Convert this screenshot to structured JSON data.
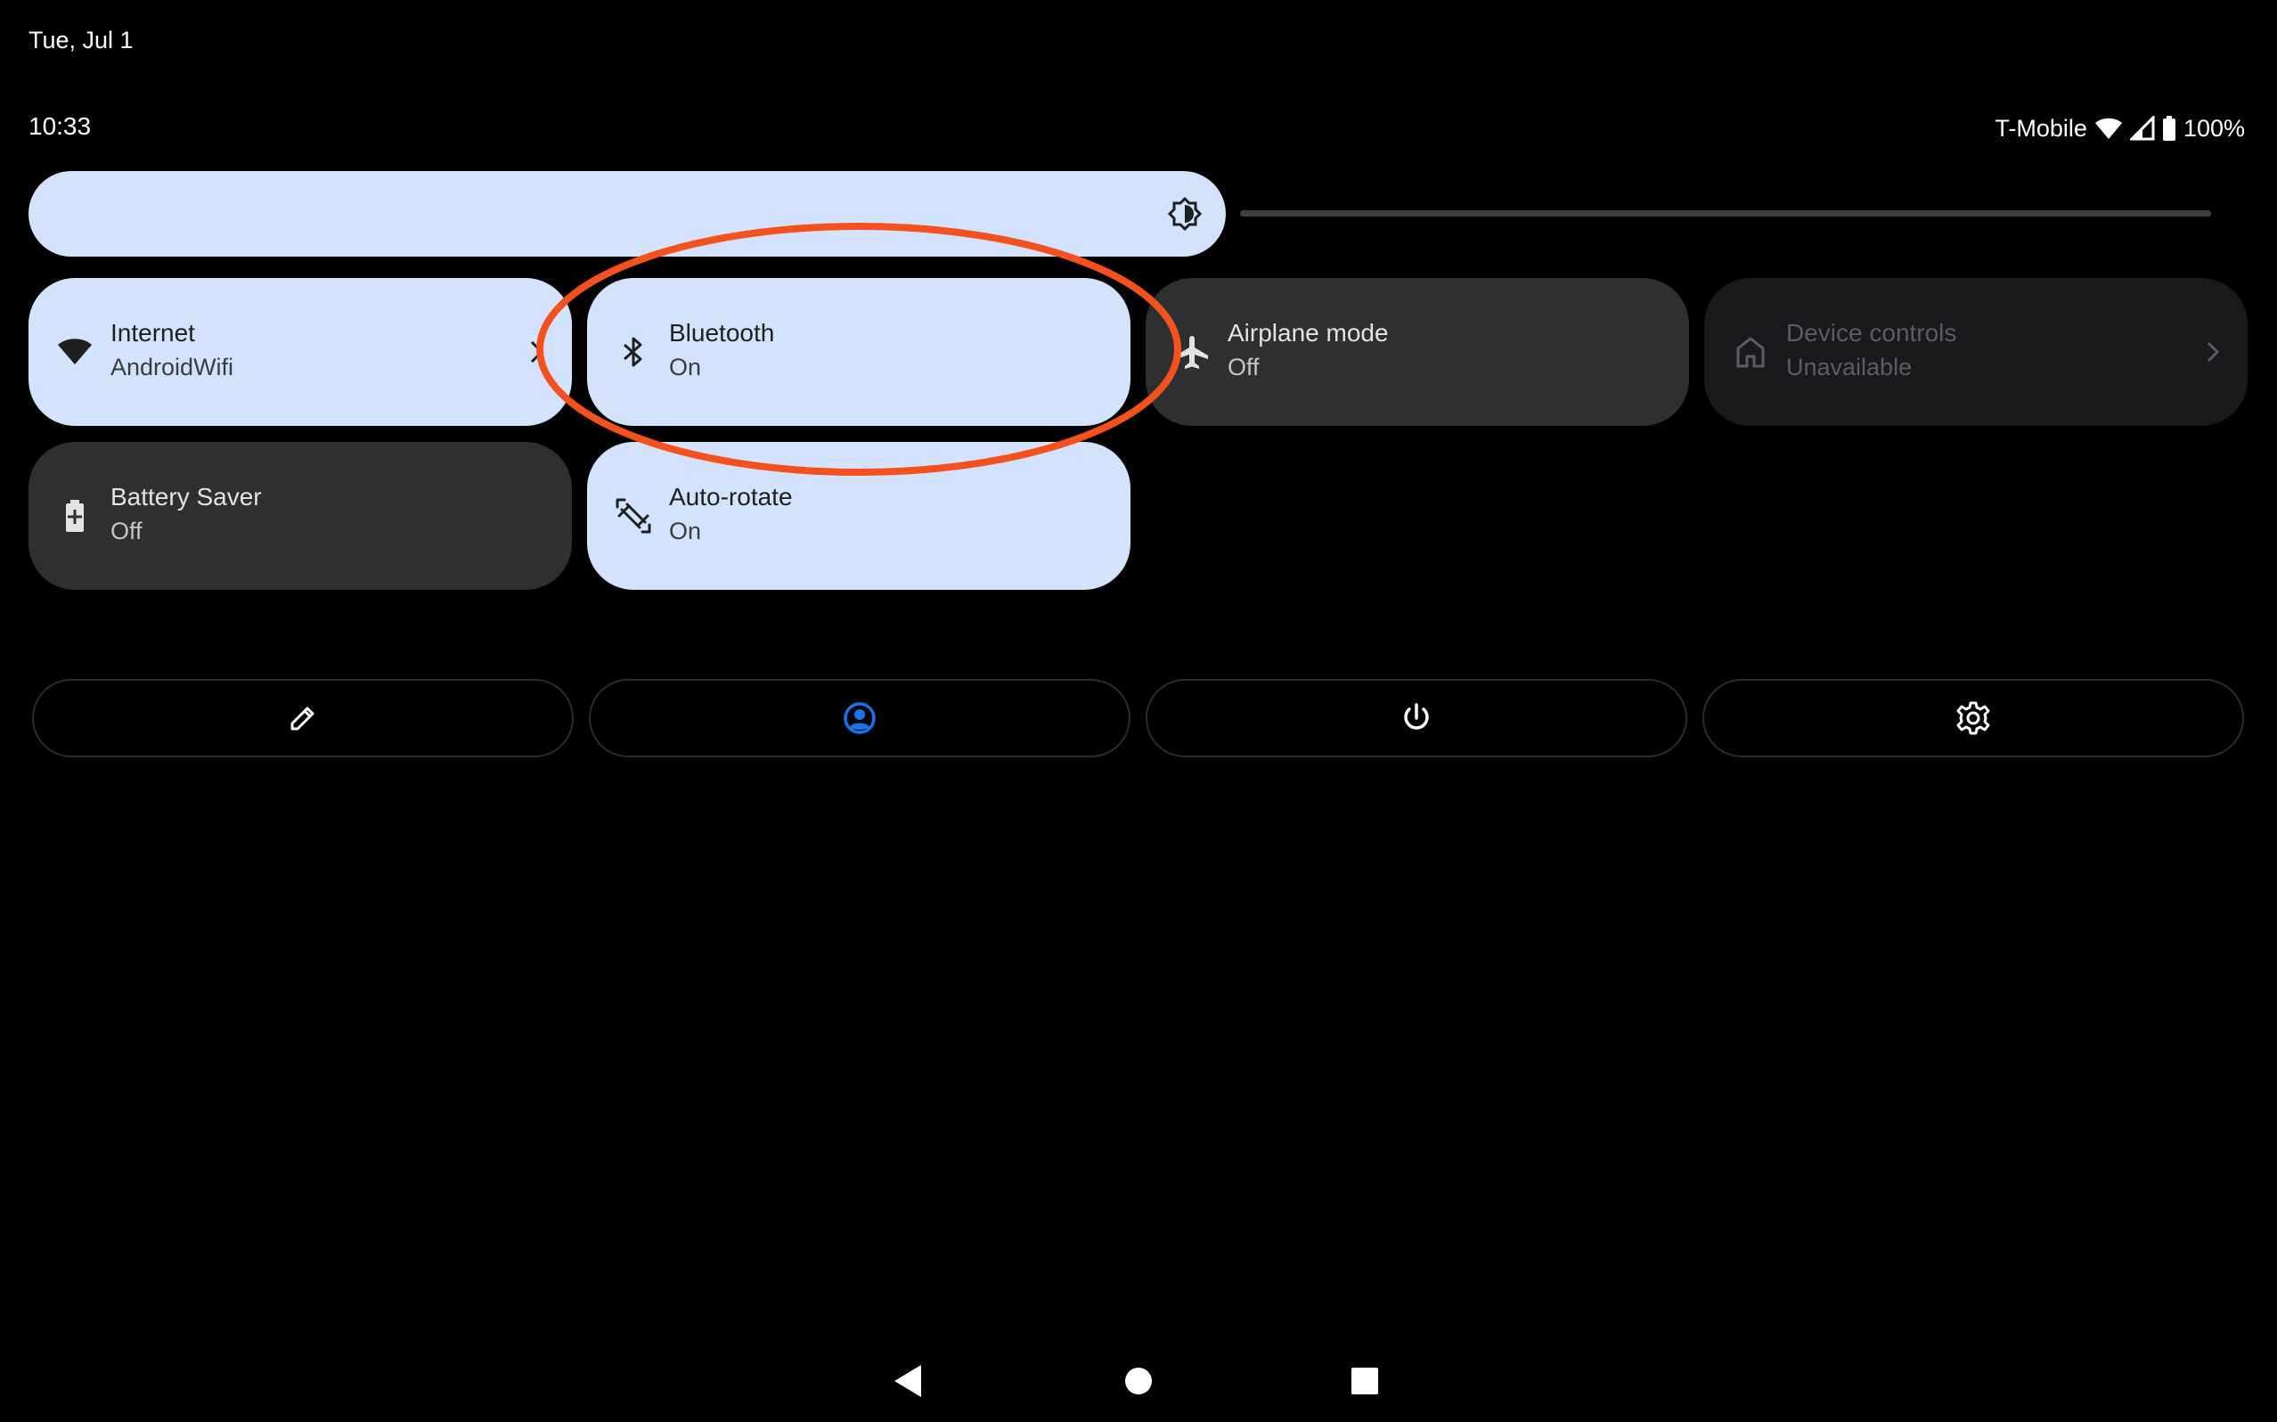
{
  "status_bar": {
    "date": "Tue, Jul 1",
    "time": "10:33",
    "carrier": "T-Mobile",
    "battery": "100%"
  },
  "brightness": {
    "level": 0.55,
    "icon": "brightness-auto-icon"
  },
  "tiles": [
    {
      "label": "Internet",
      "sub": "AndroidWifi",
      "state": "active",
      "icon": "wifi-icon"
    },
    {
      "label": "Bluetooth",
      "sub": "On",
      "state": "active",
      "icon": "bluetooth-icon"
    },
    {
      "label": "Airplane mode",
      "sub": "Off",
      "state": "inactive",
      "icon": "airplane-icon"
    },
    {
      "label": "Device controls",
      "sub": "Unavailable",
      "state": "unavailable",
      "icon": "home-icon"
    },
    {
      "label": "Battery Saver",
      "sub": "Off",
      "state": "inactive",
      "icon": "battery-saver-icon"
    },
    {
      "label": "Auto-rotate",
      "sub": "On",
      "state": "active",
      "icon": "auto-rotate-icon"
    }
  ],
  "footer": {
    "buttons": [
      "edit-icon",
      "user-icon",
      "power-icon",
      "settings-icon"
    ]
  },
  "colors": {
    "accent": "#d3e3fd",
    "user_icon": "#1a73e8",
    "annotation": "#f4511e"
  }
}
